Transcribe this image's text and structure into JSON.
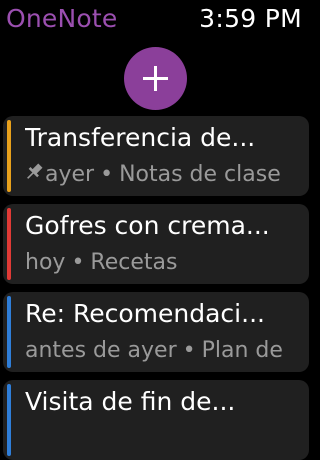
{
  "header": {
    "app_title": "OneNote",
    "time": "3:59 PM"
  },
  "add_button": {
    "icon": "plus-icon",
    "color": "#8b3f9a"
  },
  "notes": [
    {
      "title": "Transferencia de...",
      "pinned": true,
      "date": "ayer",
      "section": "Notas de clase",
      "accent": "#e8a11c"
    },
    {
      "title": "Gofres con crema...",
      "pinned": false,
      "date": "hoy",
      "section": "Recetas",
      "accent": "#e03a36"
    },
    {
      "title": "Re: Recomendaci...",
      "pinned": false,
      "date": "antes de ayer",
      "section": "Plan de",
      "accent": "#2f7ed8"
    },
    {
      "title": "Visita de fin de...",
      "pinned": false,
      "date": "",
      "section": "",
      "accent": "#2f7ed8"
    }
  ],
  "colors": {
    "brand": "#9b4fb0",
    "card_bg": "#202020",
    "meta_text": "#9a9a9a"
  }
}
